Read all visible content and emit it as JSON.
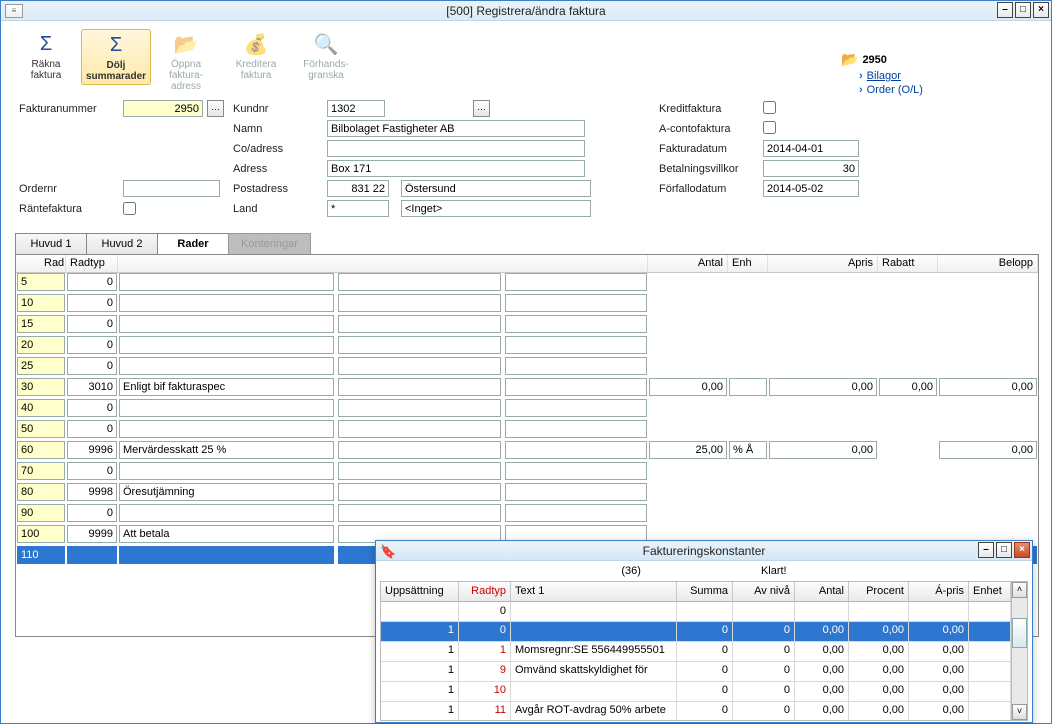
{
  "window": {
    "title": "[500]  Registrera/ändra faktura",
    "btn_min": "–",
    "btn_max": "□",
    "btn_close": "×"
  },
  "toolbar": {
    "rakna": "Räkna\nfaktura",
    "dolj": "Dölj\nsummarader",
    "oppna": "Öppna\nfaktura-\nadress",
    "kreditera": "Kreditera\nfaktura",
    "forhand": "Förhands-\ngranska"
  },
  "sidepane": {
    "folder": "2950",
    "link1": "Bilagor",
    "link2": "Order (O/L)"
  },
  "form": {
    "fakturanr_lbl": "Fakturanummer",
    "fakturanr": "2950",
    "kundnr_lbl": "Kundnr",
    "kundnr": "1302",
    "namn_lbl": "Namn",
    "namn": "Bilbolaget Fastigheter AB",
    "co_lbl": "Co/adress",
    "co": "",
    "adress_lbl": "Adress",
    "adress": "Box 171",
    "ordernr_lbl": "Ordernr",
    "ordernr": "",
    "postadr_lbl": "Postadress",
    "postnr": "831 22",
    "postort": "Östersund",
    "rantefakt_lbl": "Räntefaktura",
    "land_lbl": "Land",
    "land1": "*",
    "land2": "<Inget>",
    "kreditfakt_lbl": "Kreditfaktura",
    "aconto_lbl": "A-contofaktura",
    "fdatum_lbl": "Fakturadatum",
    "fdatum": "2014-04-01",
    "betvillkor_lbl": "Betalningsvillkor",
    "betvillkor": "30",
    "forfallo_lbl": "Förfallodatum",
    "forfallo": "2014-05-02"
  },
  "tabs": {
    "huvud1": "Huvud 1",
    "huvud2": "Huvud 2",
    "rader": "Rader",
    "konteringar": "Konteringar"
  },
  "grid": {
    "hdr_rad": "Rad",
    "hdr_radtyp": "Radtyp",
    "hdr_antal": "Antal",
    "hdr_enh": "Enh",
    "hdr_apris": "Apris",
    "hdr_rabatt": "Rabatt",
    "hdr_belopp": "Belopp",
    "rows": [
      {
        "rad": "5",
        "radtyp": "0",
        "t": "",
        "antal": "",
        "enh": "",
        "apris": "",
        "rabatt": "",
        "bel": ""
      },
      {
        "rad": "10",
        "radtyp": "0",
        "t": "",
        "antal": "",
        "enh": "",
        "apris": "",
        "rabatt": "",
        "bel": ""
      },
      {
        "rad": "15",
        "radtyp": "0",
        "t": "",
        "antal": "",
        "enh": "",
        "apris": "",
        "rabatt": "",
        "bel": ""
      },
      {
        "rad": "20",
        "radtyp": "0",
        "t": "",
        "antal": "",
        "enh": "",
        "apris": "",
        "rabatt": "",
        "bel": ""
      },
      {
        "rad": "25",
        "radtyp": "0",
        "t": "",
        "antal": "",
        "enh": "",
        "apris": "",
        "rabatt": "",
        "bel": ""
      },
      {
        "rad": "30",
        "radtyp": "3010",
        "t": "Enligt bif fakturaspec",
        "antal": "0,00",
        "enh": "",
        "apris": "0,00",
        "rabatt": "0,00",
        "bel": "0,00"
      },
      {
        "rad": "40",
        "radtyp": "0",
        "t": "",
        "antal": "",
        "enh": "",
        "apris": "",
        "rabatt": "",
        "bel": ""
      },
      {
        "rad": "50",
        "radtyp": "0",
        "t": "",
        "antal": "",
        "enh": "",
        "apris": "",
        "rabatt": "",
        "bel": ""
      },
      {
        "rad": "60",
        "radtyp": "9996",
        "t": "Mervärdesskatt 25 %",
        "antal": "25,00",
        "enh": "% Å",
        "apris": "0,00",
        "rabatt": "",
        "bel": "0,00"
      },
      {
        "rad": "70",
        "radtyp": "0",
        "t": "",
        "antal": "",
        "enh": "",
        "apris": "",
        "rabatt": "",
        "bel": ""
      },
      {
        "rad": "80",
        "radtyp": "9998",
        "t": "Öresutjämning",
        "antal": "",
        "enh": "",
        "apris": "",
        "rabatt": "",
        "bel": ""
      },
      {
        "rad": "90",
        "radtyp": "0",
        "t": "",
        "antal": "",
        "enh": "",
        "apris": "",
        "rabatt": "",
        "bel": ""
      },
      {
        "rad": "100",
        "radtyp": "9999",
        "t": "Att betala",
        "antal": "",
        "enh": "",
        "apris": "",
        "rabatt": "",
        "bel": ""
      },
      {
        "rad": "110",
        "radtyp": "",
        "t": "",
        "antal": "",
        "enh": "",
        "apris": "",
        "rabatt": "",
        "bel": "",
        "sel": true
      }
    ]
  },
  "popup": {
    "title": "Faktureringskonstanter",
    "count": "(36)",
    "status": "Klart!",
    "btn_min": "–",
    "btn_max": "□",
    "btn_close": "×",
    "hdr": {
      "upp": "Uppsättning",
      "radtyp": "Radtyp",
      "text": "Text 1",
      "sum": "Summa",
      "avn": "Av nivå",
      "ant": "Antal",
      "proc": "Procent",
      "apris": "Á-pris",
      "enh": "Enhet"
    },
    "filter_radtyp": "0",
    "rows": [
      {
        "upp": "1",
        "radtyp": "0",
        "text": "",
        "sum": "0",
        "avn": "0",
        "ant": "0,00",
        "proc": "0,00",
        "apris": "0,00",
        "sel": true
      },
      {
        "upp": "1",
        "radtyp": "1",
        "text": "Momsregnr:SE 556449955501",
        "sum": "0",
        "avn": "0",
        "ant": "0,00",
        "proc": "0,00",
        "apris": "0,00"
      },
      {
        "upp": "1",
        "radtyp": "9",
        "text": "Omvänd skattskyldighet för",
        "sum": "0",
        "avn": "0",
        "ant": "0,00",
        "proc": "0,00",
        "apris": "0,00"
      },
      {
        "upp": "1",
        "radtyp": "10",
        "text": "",
        "sum": "0",
        "avn": "0",
        "ant": "0,00",
        "proc": "0,00",
        "apris": "0,00"
      },
      {
        "upp": "1",
        "radtyp": "11",
        "text": "Avgår ROT-avdrag 50% arbete",
        "sum": "0",
        "avn": "0",
        "ant": "0,00",
        "proc": "0,00",
        "apris": "0,00"
      }
    ]
  }
}
